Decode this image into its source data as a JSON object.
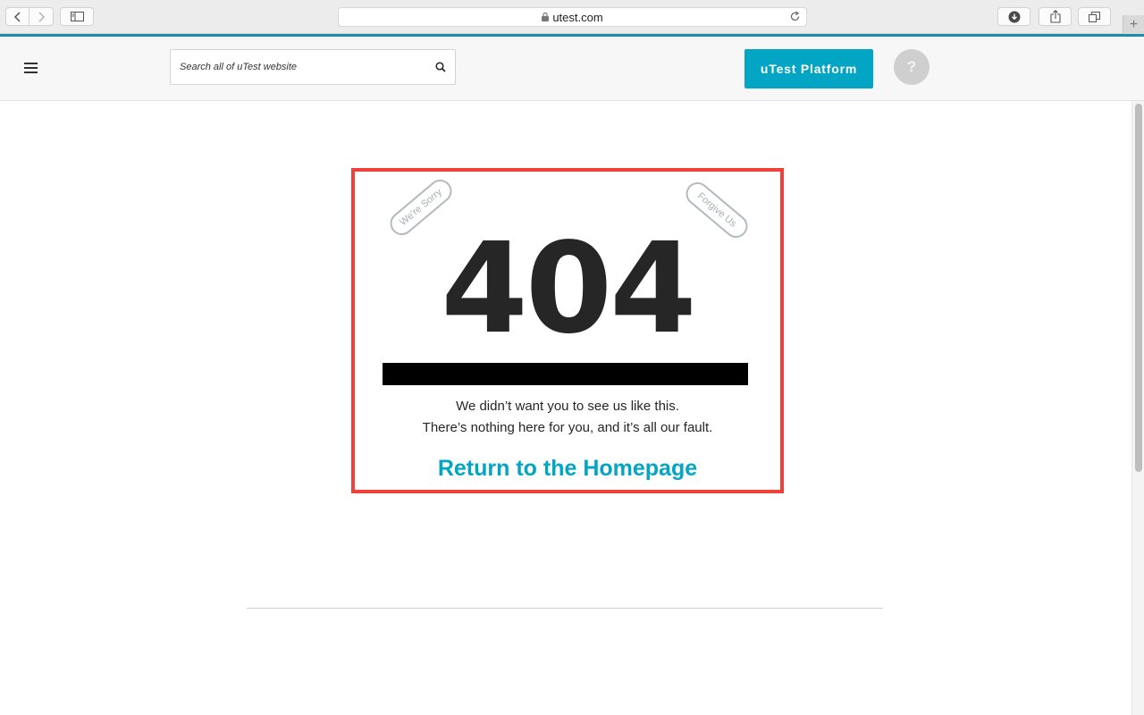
{
  "browser": {
    "url": "utest.com",
    "new_tab_label": "+"
  },
  "header": {
    "search_placeholder": "Search all of uTest website",
    "platform_button": "uTest Platform",
    "help_button": "?"
  },
  "error": {
    "ribbon_left": "We're Sorry",
    "ribbon_right": "Forgive Us",
    "code": "404",
    "message_line1": "We didn’t want you to see us like this.",
    "message_line2": "There’s nothing here for you, and it’s all our fault.",
    "home_link": "Return to the Homepage"
  },
  "colors": {
    "accent": "#03a5c5",
    "frame_highlight": "#f0403a"
  }
}
